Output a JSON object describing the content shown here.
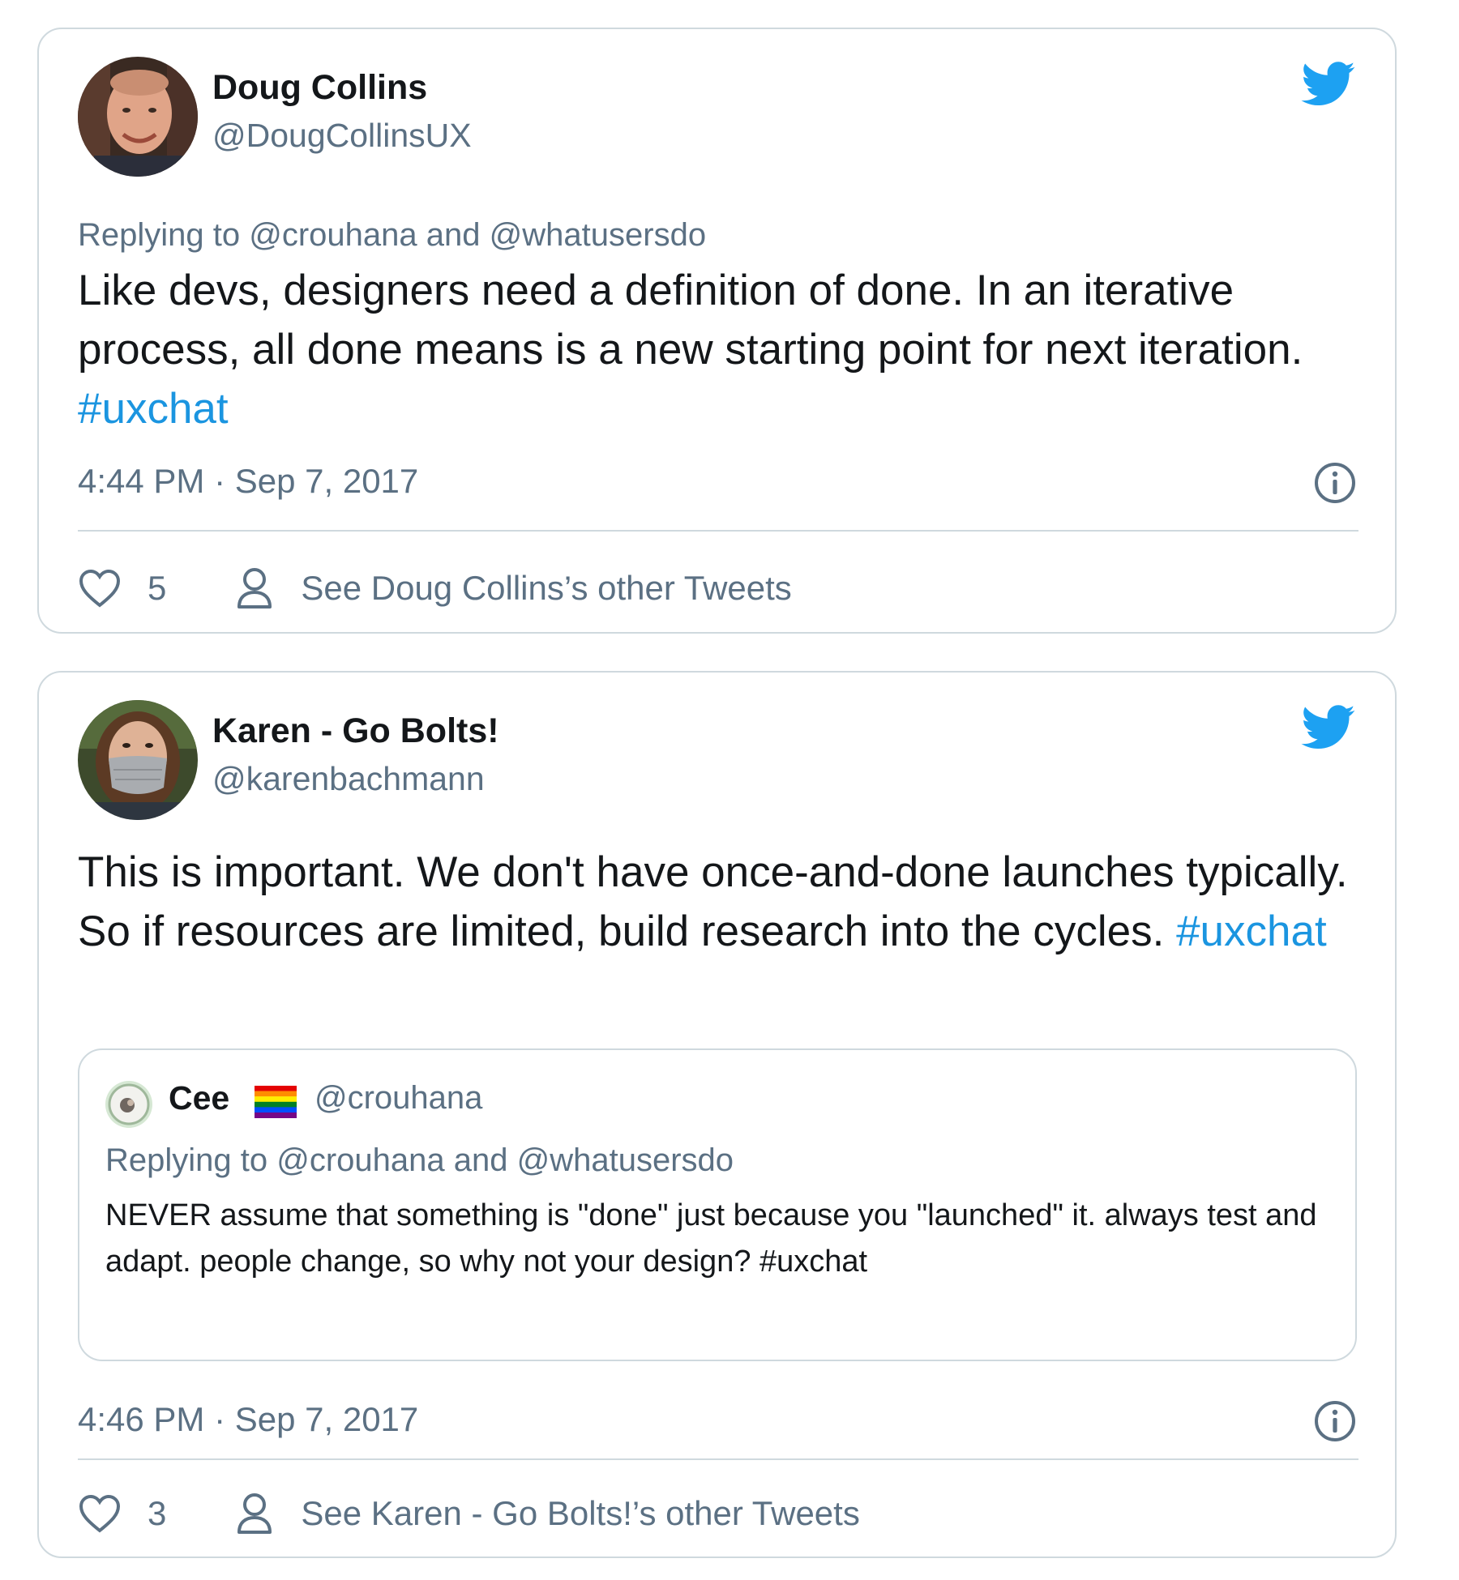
{
  "tweets": [
    {
      "author": {
        "name": "Doug Collins",
        "handle": "@DougCollinsUX"
      },
      "replying": {
        "prefix": "Replying to",
        "mention1": "@crouhana",
        "conjunction": "and",
        "mention2": "@whatusersdo"
      },
      "text": "Like devs, designers need a definition of done.  In an iterative process, all done means is a new starting point for next iteration.",
      "hashtag": "#uxchat",
      "timestamp": "4:44 PM · Sep 7, 2017",
      "likes": "5",
      "other_tweets_label": "See Doug Collins’s other Tweets"
    },
    {
      "author": {
        "name": "Karen - Go Bolts!",
        "handle": "@karenbachmann"
      },
      "text": "This is important. We don't have once-and-done launches typically. So if resources are limited, build research into the cycles.",
      "hashtag": "#uxchat",
      "quoted": {
        "name": "Cee",
        "handle": "@crouhana",
        "replying": "Replying to @crouhana and @whatusersdo",
        "text": "NEVER assume that something is \"done\" just because you \"launched\" it. always test and adapt. people change, so why not your design?  #uxchat"
      },
      "timestamp": "4:46 PM · Sep 7, 2017",
      "likes": "3",
      "other_tweets_label": "See Karen - Go Bolts!’s other Tweets"
    }
  ],
  "icons": {
    "logo": "twitter-bird-icon",
    "info": "info-icon",
    "like": "heart-icon",
    "profile": "person-icon",
    "flag": "rainbow-flag-icon"
  },
  "colors": {
    "brand": "#1da1f2",
    "hashtag": "#1b95e0",
    "secondary_text": "#5b7083",
    "border": "#cfd9de"
  }
}
